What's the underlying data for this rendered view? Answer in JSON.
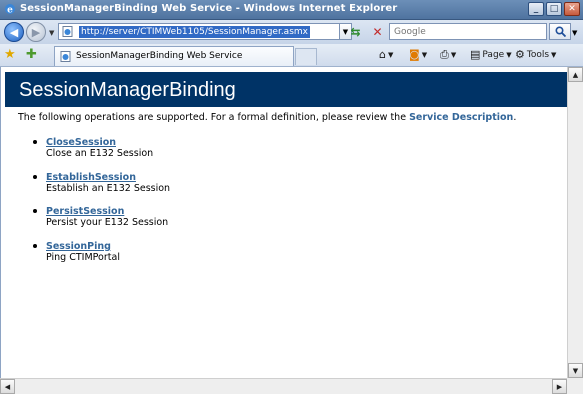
{
  "window": {
    "title": "SessionManagerBinding Web Service - Windows Internet Explorer"
  },
  "addressbar": {
    "url": "http://server/CTIMWeb1105/SessionManager.asmx"
  },
  "search": {
    "placeholder": "Google"
  },
  "tab": {
    "title": "SessionManagerBinding Web Service"
  },
  "commands": {
    "page": "Page",
    "tools": "Tools"
  },
  "content": {
    "heading": "SessionManagerBinding",
    "intro_text": "The following operations are supported. For a formal definition, please review the",
    "service_description_link": "Service Description",
    "intro_end": ".",
    "operations": [
      {
        "name": "CloseSession",
        "description": "Close an E132 Session"
      },
      {
        "name": "EstablishSession",
        "description": "Establish an E132 Session"
      },
      {
        "name": "PersistSession",
        "description": "Persist your E132 Session"
      },
      {
        "name": "SessionPing",
        "description": "Ping CTIMPortal"
      }
    ]
  },
  "colors": {
    "banner": "#003366",
    "link": "#336699",
    "url_highlight": "#316ac5"
  },
  "icons": {
    "app": "ie-icon",
    "back": "back-arrow-icon",
    "forward": "forward-arrow-icon",
    "refresh": "refresh-icon",
    "stop": "stop-icon",
    "search": "magnifier-icon",
    "favorites": "favorites-star-icon",
    "add_favorites": "add-favorites-icon",
    "home": "home-icon",
    "feeds": "feeds-icon",
    "print": "print-icon"
  }
}
